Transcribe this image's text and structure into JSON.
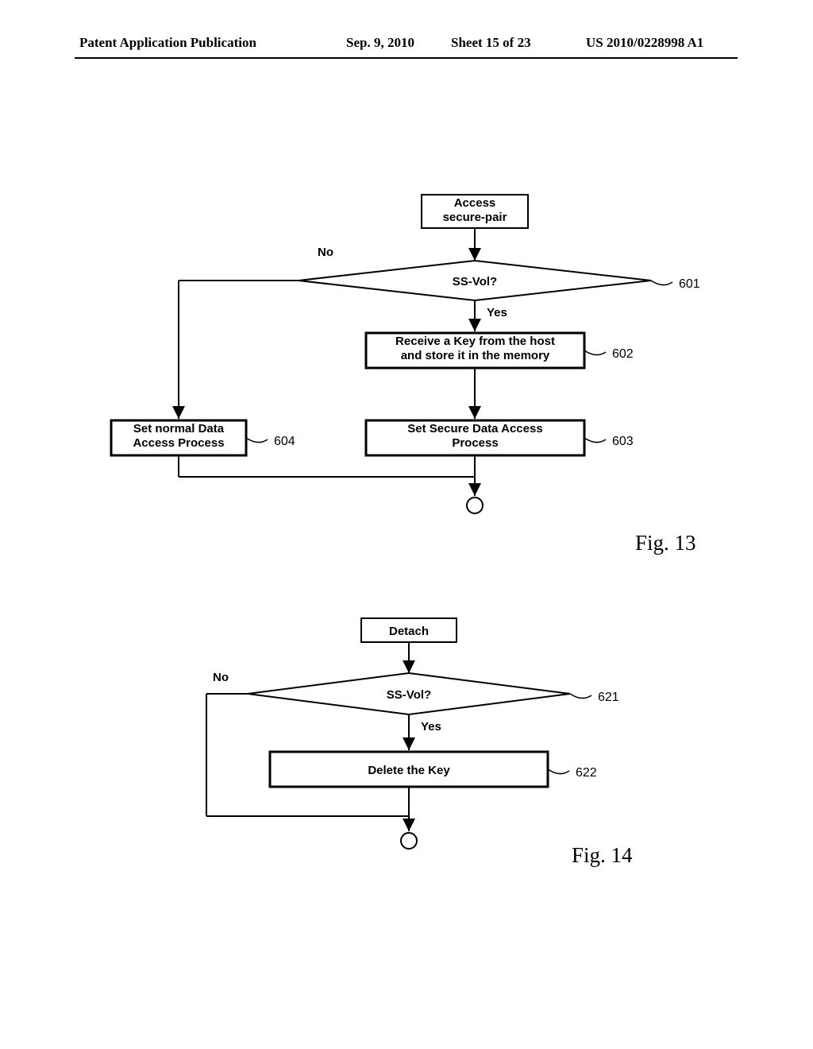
{
  "header": {
    "left": "Patent Application Publication",
    "date": "Sep. 9, 2010",
    "sheet": "Sheet 15 of 23",
    "pubno": "US 2010/0228998 A1"
  },
  "fig13": {
    "title_box": "Access\nsecure-pair",
    "decision": "SS-Vol?",
    "no": "No",
    "yes": "Yes",
    "box602": "Receive a Key from the host\nand store it in the memory",
    "box603": "Set Secure Data Access\nProcess",
    "box604": "Set normal Data\nAccess Process",
    "ref601": "601",
    "ref602": "602",
    "ref603": "603",
    "ref604": "604",
    "caption": "Fig. 13"
  },
  "fig14": {
    "title_box": "Detach",
    "decision": "SS-Vol?",
    "no": "No",
    "yes": "Yes",
    "box622": "Delete the Key",
    "ref621": "621",
    "ref622": "622",
    "caption": "Fig. 14"
  }
}
